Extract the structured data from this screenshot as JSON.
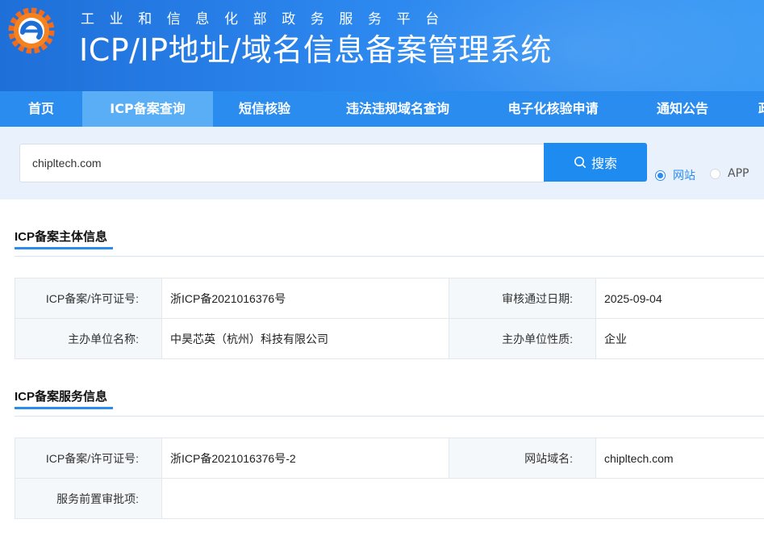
{
  "header": {
    "subtitle": "工业和信息化部政务服务平台",
    "title": "ICP/IP地址/域名信息备案管理系统",
    "logo_icon": "ministry-logo-icon"
  },
  "nav": {
    "items": [
      {
        "label": "首页",
        "active": false
      },
      {
        "label": "ICP备案查询",
        "active": true
      },
      {
        "label": "短信核验",
        "active": false
      },
      {
        "label": "违法违规域名查询",
        "active": false
      },
      {
        "label": "电子化核验申请",
        "active": false
      },
      {
        "label": "通知公告",
        "active": false
      },
      {
        "label": "政",
        "active": false
      }
    ]
  },
  "search": {
    "value": "chipltech.com",
    "button_label": "搜索",
    "button_icon": "search-icon",
    "options": [
      {
        "label": "网站",
        "checked": true
      },
      {
        "label": "APP",
        "checked": false
      }
    ]
  },
  "subject_section": {
    "title": "ICP备案主体信息",
    "rows": [
      {
        "label1": "ICP备案/许可证号:",
        "value1": "浙ICP备2021016376号",
        "label2": "审核通过日期:",
        "value2": "2025-09-04"
      },
      {
        "label1": "主办单位名称:",
        "value1": "中昊芯英（杭州）科技有限公司",
        "label2": "主办单位性质:",
        "value2": "企业"
      }
    ]
  },
  "service_section": {
    "title": "ICP备案服务信息",
    "rows": [
      {
        "label1": "ICP备案/许可证号:",
        "value1": "浙ICP备2021016376号-2",
        "label2": "网站域名:",
        "value2": "chipltech.com"
      },
      {
        "label1": "服务前置审批项:",
        "value1": ""
      }
    ]
  },
  "colors": {
    "header_blue": "#2b86ee",
    "nav_blue": "#2b8cf0",
    "nav_active": "#5aaef6",
    "search_button": "#1e8bf0",
    "search_band": "#e9f2fc"
  }
}
